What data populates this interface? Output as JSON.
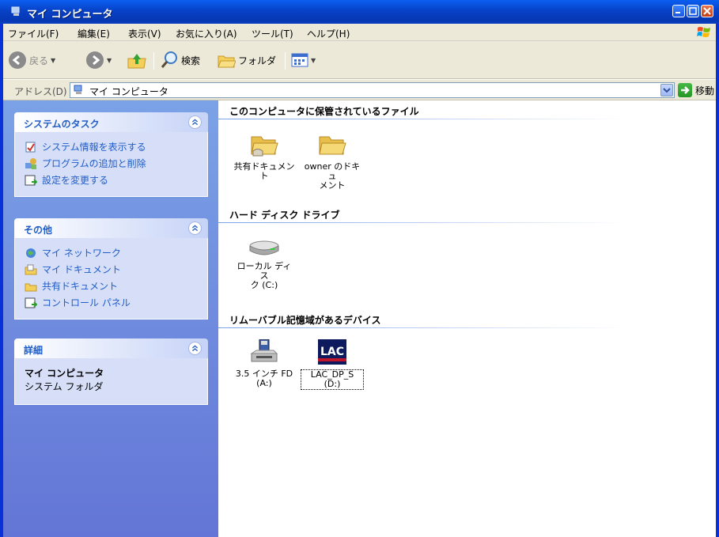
{
  "window": {
    "title": "マイ コンピュータ"
  },
  "menu": [
    "ファイル(F)",
    "編集(E)",
    "表示(V)",
    "お気に入り(A)",
    "ツール(T)",
    "ヘルプ(H)"
  ],
  "toolbar": {
    "back": "戻る",
    "search": "検索",
    "folders": "フォルダ"
  },
  "address": {
    "label": "アドレス(D)",
    "value": "マイ コンピュータ",
    "go": "移動"
  },
  "sidebar": {
    "system_tasks": {
      "title": "システムのタスク",
      "items": [
        "システム情報を表示する",
        "プログラムの追加と削除",
        "設定を変更する"
      ]
    },
    "other_places": {
      "title": "その他",
      "items": [
        "マイ ネットワーク",
        "マイ ドキュメント",
        "共有ドキュメント",
        "コントロール パネル"
      ]
    },
    "details": {
      "title": "詳細",
      "name": "マイ コンピュータ",
      "type": "システム フォルダ"
    }
  },
  "groups": {
    "files": {
      "title": "このコンピュータに保管されているファイル",
      "items": [
        {
          "line1": "共有ドキュメン",
          "line2": "ト"
        },
        {
          "line1": "owner のドキュ",
          "line2": "メント"
        }
      ]
    },
    "hdd": {
      "title": "ハード ディスク ドライブ",
      "items": [
        {
          "line1": "ローカル ディス",
          "line2": "ク (C:)"
        }
      ]
    },
    "removable": {
      "title": "リムーバブル記憶域があるデバイス",
      "items": [
        {
          "line1": "3.5 インチ FD",
          "line2": "(A:)"
        },
        {
          "line1": "LAC_DP_S (D:)",
          "line2": "",
          "icon_text": "LAC"
        }
      ]
    }
  }
}
